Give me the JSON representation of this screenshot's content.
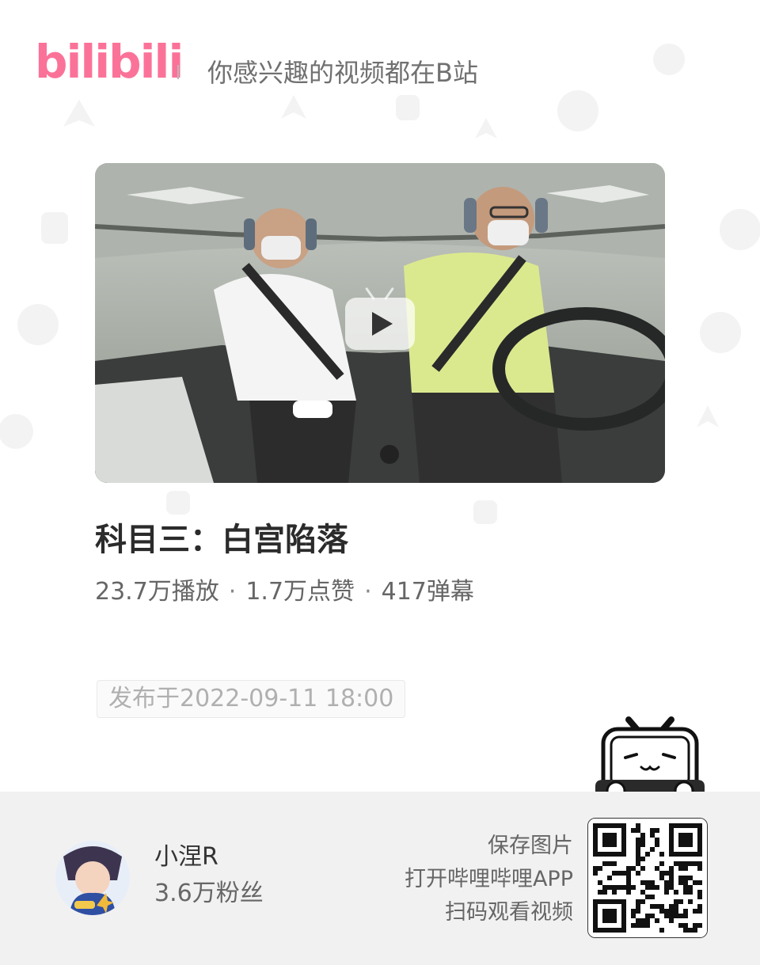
{
  "header": {
    "logo_text": "bilibili",
    "tagline": "你感兴趣的视频都在B站"
  },
  "video": {
    "title": "科目三：白宫陷落",
    "stats": {
      "plays": "23.7万播放",
      "likes": "1.7万点赞",
      "danmaku": "417弹幕",
      "separator": "·"
    },
    "publish_label": "发布于2022-09-11 18:00"
  },
  "uploader": {
    "name": "小涅R",
    "fans": "3.6万粉丝"
  },
  "cta": {
    "line1": "保存图片",
    "line2": "打开哔哩哔哩APP",
    "line3": "扫码观看视频"
  },
  "icons": {
    "play": "play-icon",
    "mascot": "bilibili-tv-mascot-icon",
    "qr": "qr-code-icon"
  },
  "colors": {
    "brand_pink": "#fb7299",
    "footer_bg": "#f1f1f1",
    "text_dark": "#2b2b2b",
    "text_muted": "#666666"
  }
}
